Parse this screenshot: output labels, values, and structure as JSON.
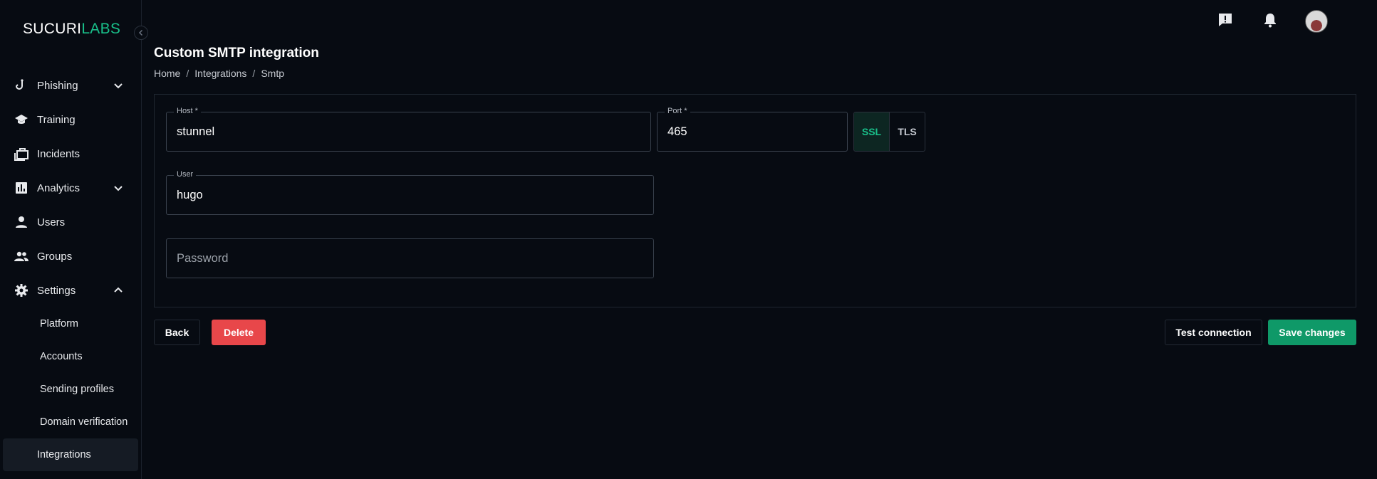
{
  "brand": {
    "part1": "SUCURI",
    "part2": "LABS",
    "accent": "#19c08a"
  },
  "sidebar": {
    "items": [
      {
        "label": "Phishing",
        "icon": "hook-icon",
        "expandable": true
      },
      {
        "label": "Training",
        "icon": "graduation-cap-icon"
      },
      {
        "label": "Incidents",
        "icon": "briefcase-icon"
      },
      {
        "label": "Analytics",
        "icon": "chart-icon",
        "expandable": true
      },
      {
        "label": "Users",
        "icon": "person-icon"
      },
      {
        "label": "Groups",
        "icon": "group-icon"
      },
      {
        "label": "Settings",
        "icon": "gear-icon",
        "expanded": true
      }
    ],
    "settings_sub": [
      {
        "label": "Platform"
      },
      {
        "label": "Accounts"
      },
      {
        "label": "Sending profiles"
      },
      {
        "label": "Domain verification"
      },
      {
        "label": "Integrations",
        "active": true
      }
    ]
  },
  "header": {
    "title": "Custom SMTP integration"
  },
  "breadcrumb": [
    "Home",
    "Integrations",
    "Smtp"
  ],
  "form": {
    "host": {
      "label": "Host *",
      "value": "stunnel"
    },
    "port": {
      "label": "Port *",
      "value": "465"
    },
    "security": {
      "options": [
        "SSL",
        "TLS"
      ],
      "selected": "SSL"
    },
    "user": {
      "label": "User",
      "value": "hugo"
    },
    "password": {
      "placeholder": "Password",
      "value": ""
    }
  },
  "actions": {
    "back": "Back",
    "delete": "Delete",
    "test": "Test connection",
    "save": "Save changes"
  }
}
